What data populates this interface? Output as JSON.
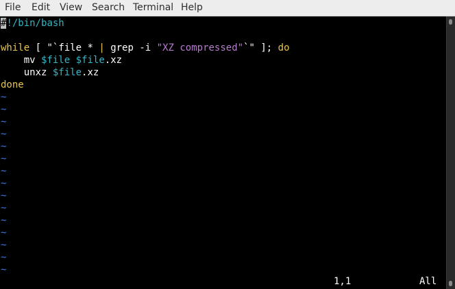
{
  "menu": [
    "File",
    "Edit",
    "View",
    "Search",
    "Terminal",
    "Help"
  ],
  "editor": {
    "line1": "#!/bin/bash",
    "line3": {
      "kw_while": "while",
      "t1": " [ \"`",
      "t2": "file * ",
      "kw_pipe": "|",
      "t3": " grep ",
      "opt": "-i",
      "t4": " ",
      "str": "\"XZ compressed\"",
      "t5": "`\" ]; ",
      "kw_do": "do"
    },
    "line4": {
      "indent": "    mv ",
      "var1": "$file",
      "sp": " ",
      "var2": "$file",
      "ext": ".xz"
    },
    "line5": {
      "indent": "    unxz ",
      "var": "$file",
      "ext": ".xz"
    },
    "line6": "done",
    "tilde": "~"
  },
  "status": {
    "position": "1,1",
    "scroll": "All"
  },
  "colors": {
    "comment": "#34b6c6",
    "keyword": "#e6c64c",
    "string": "#b77bd0",
    "tilde": "#3a7ce0"
  }
}
